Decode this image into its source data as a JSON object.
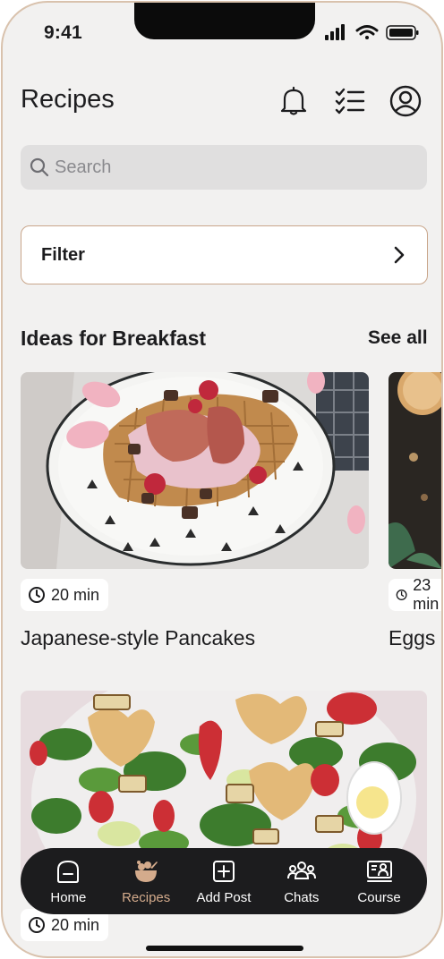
{
  "status_bar": {
    "time": "9:41"
  },
  "header": {
    "title": "Recipes",
    "icons": [
      "bell-icon",
      "checklist-icon",
      "profile-icon"
    ]
  },
  "search": {
    "placeholder": "Search",
    "value": ""
  },
  "filter": {
    "label": "Filter"
  },
  "section": {
    "title": "Ideas for Breakfast",
    "see_all": "See all"
  },
  "cards": [
    {
      "time": "20 min",
      "title": "Japanese-style Pancakes"
    },
    {
      "time": "23 min",
      "title": "Eggs Benedict"
    },
    {
      "time": "20 min",
      "title": ""
    }
  ],
  "tabbar": {
    "items": [
      {
        "label": "Home",
        "icon": "home-icon",
        "active": false
      },
      {
        "label": "Recipes",
        "icon": "recipes-icon",
        "active": true
      },
      {
        "label": "Add Post",
        "icon": "add-post-icon",
        "active": false
      },
      {
        "label": "Chats",
        "icon": "chats-icon",
        "active": false
      },
      {
        "label": "Course",
        "icon": "course-icon",
        "active": false
      }
    ]
  },
  "colors": {
    "accent": "#d4ab8c",
    "tabbar_bg": "#1c1c1e",
    "background": "#f2f1f0",
    "frame": "#d9c2ad"
  }
}
